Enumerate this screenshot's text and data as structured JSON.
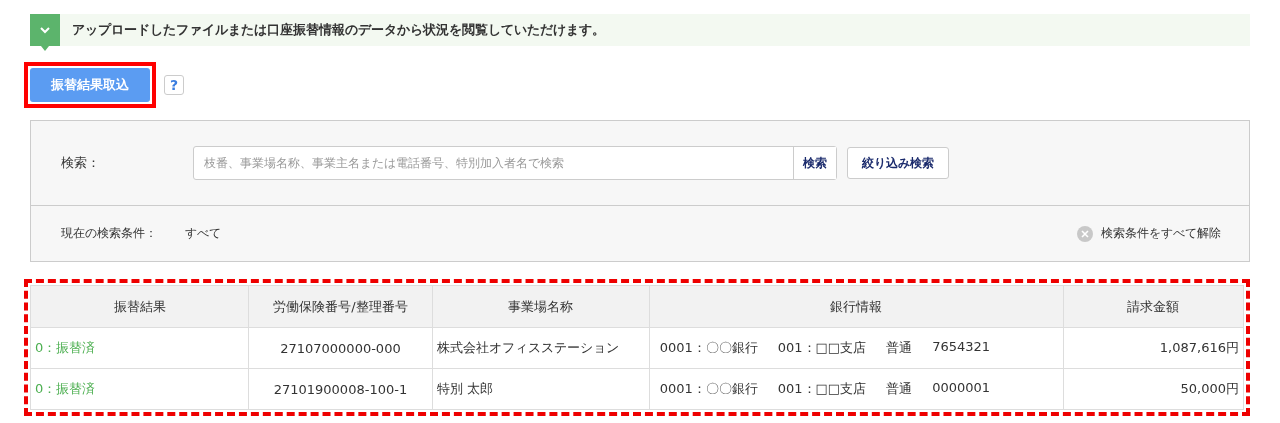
{
  "notice": {
    "text": "アップロードしたファイルまたは口座振替情報のデータから状況を閲覧していただけます。"
  },
  "import_button": {
    "label": "振替結果取込",
    "highlighted": true
  },
  "help": {
    "label": "?"
  },
  "search": {
    "label": "検索：",
    "placeholder": "枝番、事業場名称、事業主名または電話番号、特別加入者名で検索",
    "button": "検索",
    "filter_button": "絞り込み検索"
  },
  "conditions": {
    "label": "現在の検索条件：",
    "value": "すべて",
    "clear": "検索条件をすべて解除"
  },
  "table": {
    "highlighted": true,
    "columns": [
      "振替結果",
      "労働保険番号/整理番号",
      "事業場名称",
      "銀行情報",
      "請求金額"
    ],
    "rows": [
      {
        "result": "0：振替済",
        "number": "27107000000-000",
        "name": "株式会社オフィスステーション",
        "bank": [
          "0001：〇〇銀行",
          "001：□□支店",
          "普通",
          "7654321"
        ],
        "amount": "1,087,616円"
      },
      {
        "result": "0：振替済",
        "number": "27101900008-100-1",
        "name": "特別 太郎",
        "bank": [
          "0001：〇〇銀行",
          "001：□□支店",
          "普通",
          "0000001"
        ],
        "amount": "50,000円"
      }
    ]
  }
}
